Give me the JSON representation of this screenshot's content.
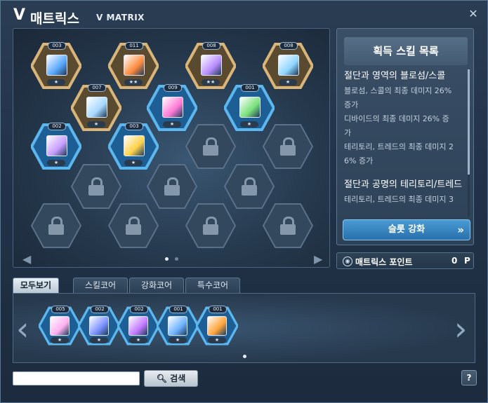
{
  "window": {
    "title_v": "V",
    "title_ko": "매트릭스",
    "title_en": "V MATRIX",
    "close_label": "✕"
  },
  "colors": {
    "gold_frame": "#c8a46a",
    "blue_frame": "#2f8ed0",
    "locked": "#3a4d61",
    "accent": "#3c8fd0"
  },
  "matrix": {
    "slots": [
      {
        "type": "equipped",
        "frame": "gold",
        "level": "003",
        "stars": "★",
        "icon": "skill-flame-blue-orange-icon"
      },
      {
        "type": "equipped",
        "frame": "gold",
        "level": "011",
        "stars": "★★",
        "icon": "skill-flame-orange-blue-icon"
      },
      {
        "type": "equipped",
        "frame": "gold",
        "level": "008",
        "stars": "★★",
        "icon": "skill-crystal-purple-icon"
      },
      {
        "type": "equipped",
        "frame": "gold",
        "level": "008",
        "stars": "★",
        "icon": "skill-wing-blue-icon"
      },
      {
        "type": "equipped",
        "frame": "gold",
        "level": "007",
        "stars": "★",
        "icon": "skill-ice-slash-icon"
      },
      {
        "type": "equipped",
        "frame": "blue",
        "level": "009",
        "stars": "★",
        "icon": "skill-pink-burst-icon"
      },
      {
        "type": "equipped",
        "frame": "blue",
        "level": "001",
        "stars": "★",
        "icon": "skill-green-eye-icon"
      },
      {
        "type": "equipped",
        "frame": "blue",
        "level": "002",
        "stars": "★",
        "icon": "skill-purple-wing-icon"
      },
      {
        "type": "equipped",
        "frame": "blue",
        "level": "003",
        "stars": "★",
        "icon": "skill-gold-armor-icon"
      },
      {
        "type": "locked"
      },
      {
        "type": "locked"
      },
      {
        "type": "locked"
      },
      {
        "type": "locked"
      },
      {
        "type": "locked"
      },
      {
        "type": "locked"
      },
      {
        "type": "locked"
      },
      {
        "type": "locked"
      },
      {
        "type": "locked"
      },
      {
        "type": "locked"
      }
    ],
    "page_indicator": {
      "current": 1,
      "total": 2
    }
  },
  "skill_list": {
    "header": "획득 스킬 목록",
    "entries": [
      {
        "title": "절단과 영역의 블로섬/스콜",
        "lines": [
          "블로섬, 스콜의 최종 데미지 26%",
          "증가",
          "디바이드의 최종 데미지 26% 증",
          "가",
          "테리토리, 트레드의 최종 데미지 2",
          "6% 증가"
        ]
      },
      {
        "title": "절단과 공명의 테리토리/트레드",
        "lines": [
          "테리토리, 트레드의 최종 데미지 3"
        ]
      }
    ],
    "enhance_button": "슬롯 강화",
    "enhance_arrow": "»"
  },
  "points": {
    "label": "매트릭스 포인트",
    "value": "0",
    "unit": "P"
  },
  "tabs": [
    {
      "label": "모두보기",
      "active": true
    },
    {
      "label": "스킬코어",
      "active": false
    },
    {
      "label": "강화코어",
      "active": false
    },
    {
      "label": "특수코어",
      "active": false
    }
  ],
  "inventory": {
    "cores": [
      {
        "level": "005",
        "stars": "★",
        "icon": "core-butterfly-icon"
      },
      {
        "level": "002",
        "stars": "★",
        "icon": "core-blue-burst-icon"
      },
      {
        "level": "002",
        "stars": "★",
        "icon": "core-purple-swirl-icon"
      },
      {
        "level": "001",
        "stars": "★",
        "icon": "core-blue-spirit-icon"
      },
      {
        "level": "001",
        "stars": "★",
        "icon": "core-fire-sphere-icon"
      }
    ]
  },
  "search": {
    "placeholder": "",
    "button_label": "검색",
    "help_label": "?"
  }
}
